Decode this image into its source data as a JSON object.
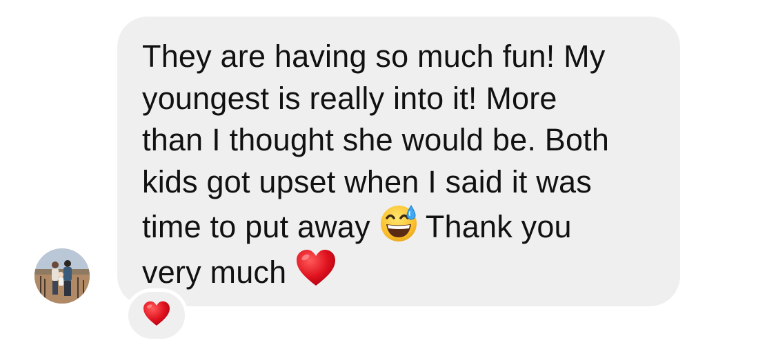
{
  "message": {
    "line1": "They are having so much fun! My",
    "line2": "youngest is really into it! More",
    "line3": "than I thought she would be. Both",
    "line4": "kids got upset when I said it was",
    "line5_before": "time to put away",
    "line5_after": "Thank you",
    "line6": "very much",
    "emoji_1": "grinning-face-with-sweat-icon",
    "emoji_2": "red-heart-icon"
  },
  "reaction": {
    "emoji": "red-heart-icon"
  },
  "colors": {
    "bubble": "#efefef",
    "text": "#111111",
    "heart": "#e0131f"
  }
}
